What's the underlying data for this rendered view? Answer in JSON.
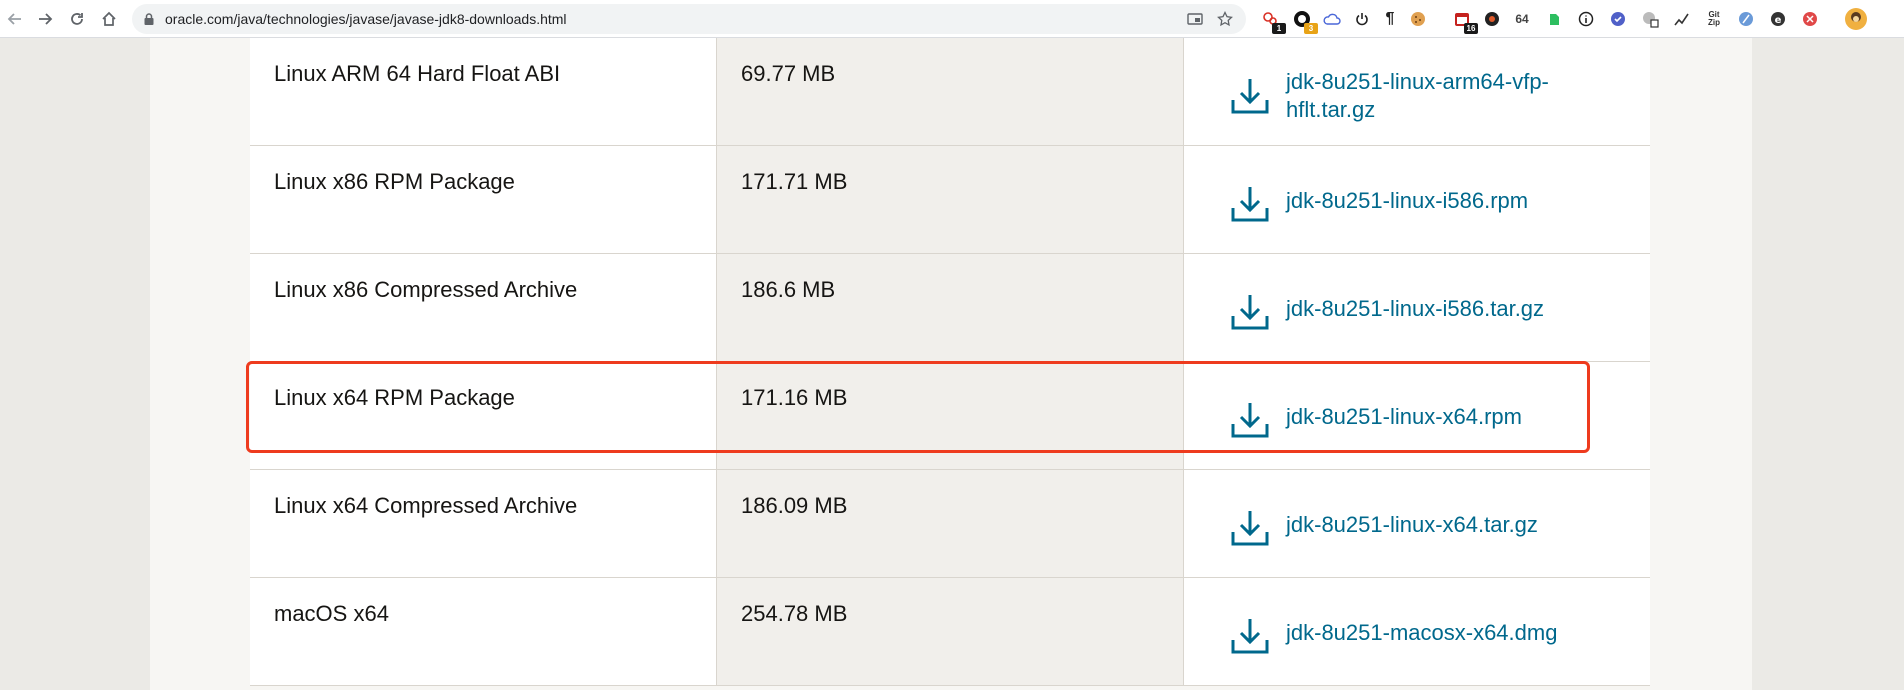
{
  "browser": {
    "url": "oracle.com/java/technologies/javase/javase-jdk8-downloads.html",
    "extensions": [
      {
        "icon": "puzzle-red-icon",
        "badge": "1"
      },
      {
        "icon": "ghost-icon",
        "badge": "3"
      },
      {
        "icon": "cloud-icon",
        "badge": ""
      },
      {
        "icon": "power-icon",
        "badge": ""
      },
      {
        "icon": "pilcrow-icon",
        "badge": ""
      },
      {
        "icon": "cookie-icon",
        "badge": ""
      },
      {
        "icon": "calendar-icon",
        "badge": "16"
      },
      {
        "icon": "bug-icon",
        "badge": ""
      },
      {
        "icon": "64-icon",
        "badge": ""
      },
      {
        "icon": "evernote-icon",
        "badge": ""
      },
      {
        "icon": "info-icon",
        "badge": ""
      },
      {
        "icon": "check-circle-icon",
        "badge": ""
      },
      {
        "icon": "translate-icon",
        "badge": ""
      },
      {
        "icon": "graph-icon",
        "badge": ""
      },
      {
        "icon": "gitzip-icon",
        "badge": ""
      },
      {
        "icon": "feather-icon",
        "badge": ""
      },
      {
        "icon": "e-circle-icon",
        "badge": ""
      },
      {
        "icon": "block-icon",
        "badge": ""
      },
      {
        "icon": "avatar-icon",
        "badge": ""
      }
    ],
    "extension_labels": {
      "e64": "64",
      "gitzip_top": "Git",
      "gitzip_bottom": "Zip"
    }
  },
  "downloads": [
    {
      "product": "Linux ARM 64 Hard Float ABI",
      "size": "69.77 MB",
      "file_line1": "jdk-8u251-linux-arm64-vfp-",
      "file_line2": "hflt.tar.gz"
    },
    {
      "product": "Linux x86 RPM Package",
      "size": "171.71 MB",
      "file_line1": "jdk-8u251-linux-i586.rpm",
      "file_line2": ""
    },
    {
      "product": "Linux x86 Compressed Archive",
      "size": "186.6 MB",
      "file_line1": "jdk-8u251-linux-i586.tar.gz",
      "file_line2": ""
    },
    {
      "product": "Linux x64 RPM Package",
      "size": "171.16 MB",
      "file_line1": "jdk-8u251-linux-x64.rpm",
      "file_line2": ""
    },
    {
      "product": "Linux x64 Compressed Archive",
      "size": "186.09 MB",
      "file_line1": "jdk-8u251-linux-x64.tar.gz",
      "file_line2": ""
    },
    {
      "product": "macOS x64",
      "size": "254.78 MB",
      "file_line1": "jdk-8u251-macosx-x64.dmg",
      "file_line2": ""
    }
  ],
  "colors": {
    "link": "#00688c",
    "highlight": "#ee3b1e"
  }
}
